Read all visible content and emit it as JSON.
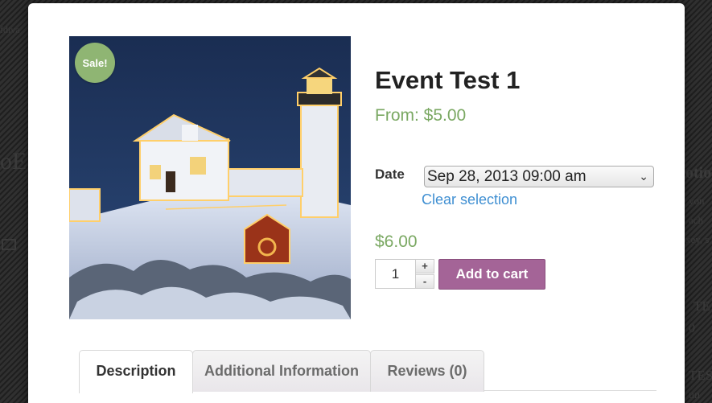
{
  "background": {
    "fragments": [
      "fdiva",
      "oE",
      "otio",
      "yon",
      "ach",
      "xey, s",
      "TE",
      "0",
      "TES",
      "un"
    ]
  },
  "product": {
    "badge": "Sale!",
    "title": "Event Test 1",
    "price_range": "From: $5.00",
    "date_label": "Date",
    "date_selected": "Sep 28, 2013 09:00 am",
    "clear_selection": "Clear selection",
    "price": "$6.00",
    "quantity": "1",
    "qty_plus": "+",
    "qty_minus": "-",
    "add_to_cart": "Add to cart",
    "image_subject": "snow-covered lighthouse with holiday lights at night"
  },
  "tabs": [
    {
      "label": "Description",
      "active": true
    },
    {
      "label": "Additional Information",
      "active": false
    },
    {
      "label": "Reviews (0)",
      "active": false
    }
  ],
  "colors": {
    "accent_green": "#7aa862",
    "button_purple": "#a46497",
    "link_blue": "#3f8fd2",
    "badge_green": "#8fb573"
  }
}
